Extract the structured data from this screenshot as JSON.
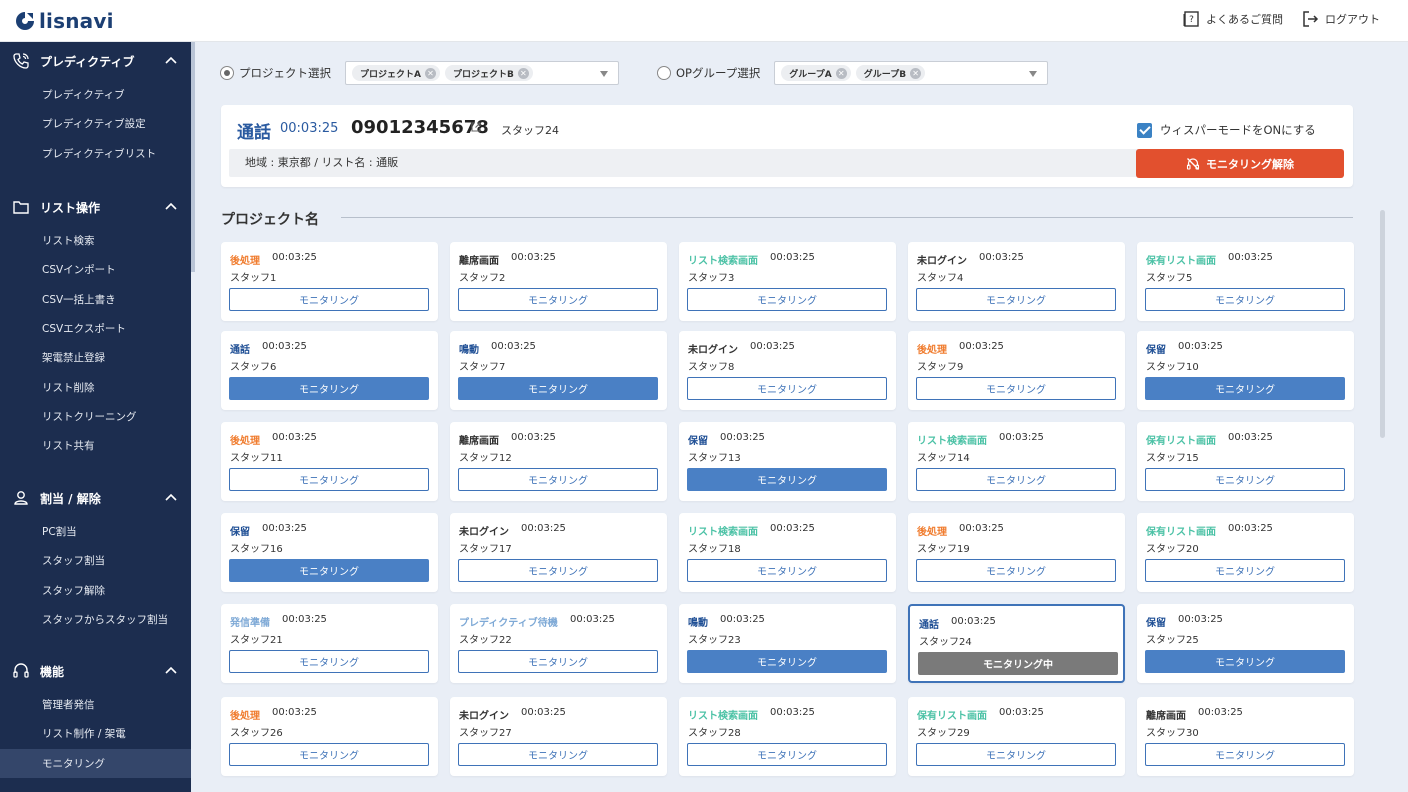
{
  "header": {
    "logo_text": "lisnavi",
    "faq_label": "よくあるご質問",
    "logout_label": "ログアウト"
  },
  "sidebar": [
    {
      "title": "プレディクティブ",
      "icon": "phone-icon",
      "items": [
        "プレディクティブ",
        "プレディクティブ設定",
        "プレディクティブリスト"
      ]
    },
    {
      "title": "リスト操作",
      "icon": "folder-icon",
      "items": [
        "リスト検索",
        "CSVインポート",
        "CSV一括上書き",
        "CSVエクスポート",
        "架電禁止登録",
        "リスト削除",
        "リストクリーニング",
        "リスト共有"
      ]
    },
    {
      "title": "割当 / 解除",
      "icon": "user-icon",
      "items": [
        "PC割当",
        "スタッフ割当",
        "スタッフ解除",
        "スタッフからスタッフ割当"
      ]
    },
    {
      "title": "機能",
      "icon": "headset-icon",
      "items": [
        "管理者発信",
        "リスト制作 / 架電",
        "モニタリング"
      ]
    }
  ],
  "selectors": {
    "project_label": "プロジェクト選択",
    "project_chips": [
      "プロジェクトA",
      "プロジェクトB"
    ],
    "group_label": "OPグループ選択",
    "group_chips": [
      "グループA",
      "グループB"
    ]
  },
  "call": {
    "status": "通話",
    "time": "00:03:25",
    "number": "09012345678",
    "staff": "スタッフ24",
    "info": "地域 : 東京都 / リスト名 : 通販",
    "whisper_label": "ウィスパーモードをONにする",
    "release_label": "モニタリング解除"
  },
  "section_title": "プロジェクト名",
  "colors": {
    "orange": "#f07c2e",
    "dark": "#333333",
    "teal": "#4cc2a6",
    "navy": "#1f4f95",
    "lightblue": "#7ea9d6",
    "release": "#e2502e"
  },
  "cards": [
    {
      "status": "後処理",
      "color": "orange",
      "time": "00:03:25",
      "staff": "スタッフ1",
      "btn": "モニタリング",
      "style": "outline"
    },
    {
      "status": "離席画面",
      "color": "dark",
      "time": "00:03:25",
      "staff": "スタッフ2",
      "btn": "モニタリング",
      "style": "outline"
    },
    {
      "status": "リスト検索画面",
      "color": "teal",
      "time": "00:03:25",
      "staff": "スタッフ3",
      "btn": "モニタリング",
      "style": "outline"
    },
    {
      "status": "未ログイン",
      "color": "dark",
      "time": "00:03:25",
      "staff": "スタッフ4",
      "btn": "モニタリング",
      "style": "outline"
    },
    {
      "status": "保有リスト画面",
      "color": "teal",
      "time": "00:03:25",
      "staff": "スタッフ5",
      "btn": "モニタリング",
      "style": "outline"
    },
    {
      "status": "通話",
      "color": "navy",
      "time": "00:03:25",
      "staff": "スタッフ6",
      "btn": "モニタリング",
      "style": "filled"
    },
    {
      "status": "鳴動",
      "color": "navy",
      "time": "00:03:25",
      "staff": "スタッフ7",
      "btn": "モニタリング",
      "style": "filled"
    },
    {
      "status": "未ログイン",
      "color": "dark",
      "time": "00:03:25",
      "staff": "スタッフ8",
      "btn": "モニタリング",
      "style": "outline"
    },
    {
      "status": "後処理",
      "color": "orange",
      "time": "00:03:25",
      "staff": "スタッフ9",
      "btn": "モニタリング",
      "style": "outline"
    },
    {
      "status": "保留",
      "color": "navy",
      "time": "00:03:25",
      "staff": "スタッフ10",
      "btn": "モニタリング",
      "style": "filled"
    },
    {
      "status": "後処理",
      "color": "orange",
      "time": "00:03:25",
      "staff": "スタッフ11",
      "btn": "モニタリング",
      "style": "outline"
    },
    {
      "status": "離席画面",
      "color": "dark",
      "time": "00:03:25",
      "staff": "スタッフ12",
      "btn": "モニタリング",
      "style": "outline"
    },
    {
      "status": "保留",
      "color": "navy",
      "time": "00:03:25",
      "staff": "スタッフ13",
      "btn": "モニタリング",
      "style": "filled"
    },
    {
      "status": "リスト検索画面",
      "color": "teal",
      "time": "00:03:25",
      "staff": "スタッフ14",
      "btn": "モニタリング",
      "style": "outline"
    },
    {
      "status": "保有リスト画面",
      "color": "teal",
      "time": "00:03:25",
      "staff": "スタッフ15",
      "btn": "モニタリング",
      "style": "outline"
    },
    {
      "status": "保留",
      "color": "navy",
      "time": "00:03:25",
      "staff": "スタッフ16",
      "btn": "モニタリング",
      "style": "filled"
    },
    {
      "status": "未ログイン",
      "color": "dark",
      "time": "00:03:25",
      "staff": "スタッフ17",
      "btn": "モニタリング",
      "style": "outline"
    },
    {
      "status": "リスト検索画面",
      "color": "teal",
      "time": "00:03:25",
      "staff": "スタッフ18",
      "btn": "モニタリング",
      "style": "outline"
    },
    {
      "status": "後処理",
      "color": "orange",
      "time": "00:03:25",
      "staff": "スタッフ19",
      "btn": "モニタリング",
      "style": "outline"
    },
    {
      "status": "保有リスト画面",
      "color": "teal",
      "time": "00:03:25",
      "staff": "スタッフ20",
      "btn": "モニタリング",
      "style": "outline"
    },
    {
      "status": "発信準備",
      "color": "lightblue",
      "time": "00:03:25",
      "staff": "スタッフ21",
      "btn": "モニタリング",
      "style": "outline"
    },
    {
      "status": "プレディクティブ待機",
      "color": "lightblue",
      "time": "00:03:25",
      "staff": "スタッフ22",
      "btn": "モニタリング",
      "style": "outline"
    },
    {
      "status": "鳴動",
      "color": "navy",
      "time": "00:03:25",
      "staff": "スタッフ23",
      "btn": "モニタリング",
      "style": "filled"
    },
    {
      "status": "通話",
      "color": "navy",
      "time": "00:03:25",
      "staff": "スタッフ24",
      "btn": "モニタリング中",
      "style": "active",
      "selected": true
    },
    {
      "status": "保留",
      "color": "navy",
      "time": "00:03:25",
      "staff": "スタッフ25",
      "btn": "モニタリング",
      "style": "filled"
    },
    {
      "status": "後処理",
      "color": "orange",
      "time": "00:03:25",
      "staff": "スタッフ26",
      "btn": "モニタリング",
      "style": "outline"
    },
    {
      "status": "未ログイン",
      "color": "dark",
      "time": "00:03:25",
      "staff": "スタッフ27",
      "btn": "モニタリング",
      "style": "outline"
    },
    {
      "status": "リスト検索画面",
      "color": "teal",
      "time": "00:03:25",
      "staff": "スタッフ28",
      "btn": "モニタリング",
      "style": "outline"
    },
    {
      "status": "保有リスト画面",
      "color": "teal",
      "time": "00:03:25",
      "staff": "スタッフ29",
      "btn": "モニタリング",
      "style": "outline"
    },
    {
      "status": "離席画面",
      "color": "dark",
      "time": "00:03:25",
      "staff": "スタッフ30",
      "btn": "モニタリング",
      "style": "outline"
    }
  ]
}
